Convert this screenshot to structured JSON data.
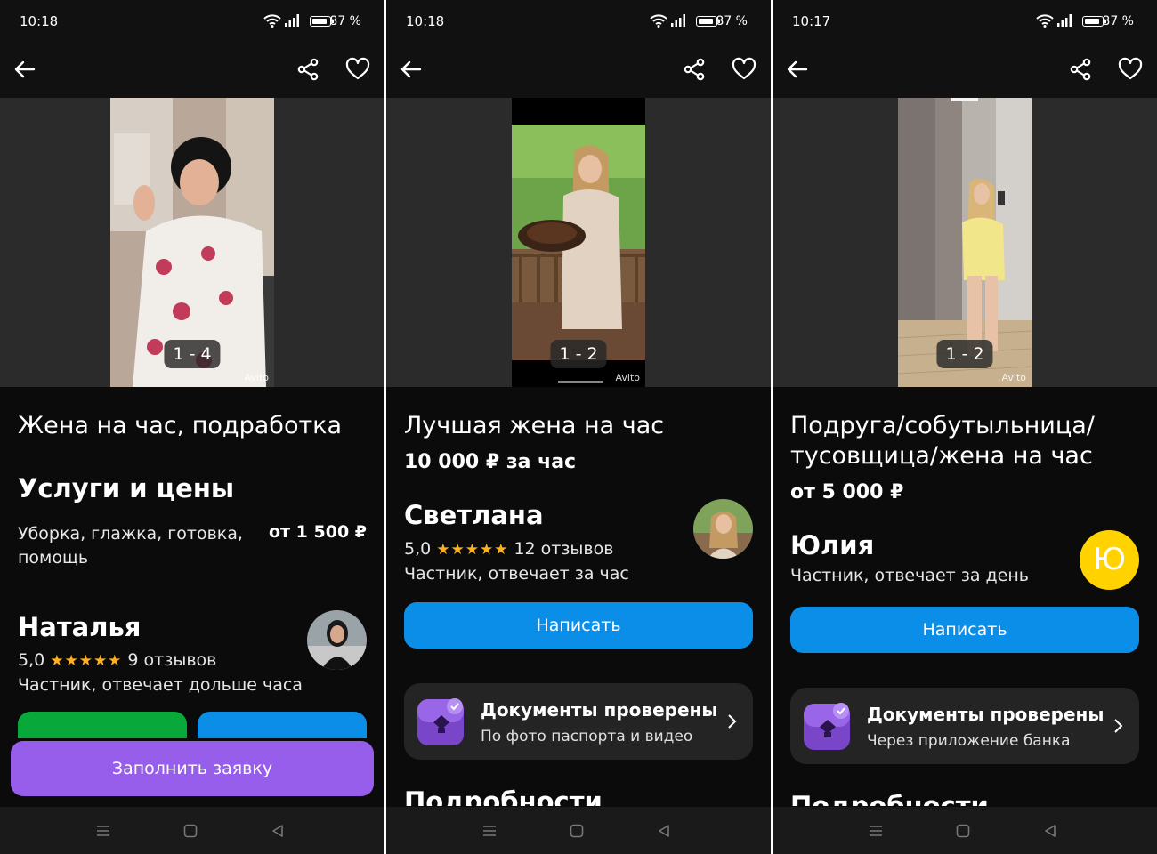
{
  "status": {
    "time1": "10:18",
    "time2": "10:18",
    "time3": "10:17",
    "battery": "87 %"
  },
  "screens": [
    {
      "counter": "1 - 4",
      "watermark": "Avito",
      "title": "Жена на час, подработка",
      "section": "Услуги и цены",
      "service": "Уборка, глажка, готовка, помощь",
      "service_price": "от 1 500 ₽",
      "seller": "Наталья",
      "rating": "5,0",
      "stars": "★★★★★",
      "reviews": "9 отзывов",
      "seller_sub": "Частник, отвечает дольше часа",
      "apply_button": "Заполнить заявку"
    },
    {
      "counter": "1 - 2",
      "watermark": "Avito",
      "title": "Лучшая жена на час",
      "price": "10 000 ₽ за час",
      "seller": "Светлана",
      "rating": "5,0",
      "stars": "★★★★★",
      "reviews": "12 отзывов",
      "seller_sub": "Частник, отвечает за час",
      "write_button": "Написать",
      "docs_title": "Документы проверены",
      "docs_sub": "По фото паспорта и видео",
      "details": "Подробности"
    },
    {
      "counter": "1 - 2",
      "watermark": "Avito",
      "title_line1": "Подруга/собутыльница/",
      "title_line2": "тусовщица/жена на час",
      "price": "от 5 000 ₽",
      "seller": "Юлия",
      "avatar_letter": "Ю",
      "seller_sub": "Частник, отвечает за день",
      "write_button": "Написать",
      "docs_title": "Документы проверены",
      "docs_sub": "Через приложение банка",
      "details": "Подробности"
    }
  ],
  "colors": {
    "accent_blue": "#0a8ee8",
    "accent_purple": "#965eeb",
    "accent_green": "#09a83a",
    "star": "#ffb020",
    "avatar_yellow": "#ffd200",
    "background": "#0b0b0b"
  },
  "icons": [
    "back-arrow-icon",
    "share-icon",
    "heart-icon",
    "wifi-icon",
    "signal-icon",
    "battery-icon",
    "verified-docs-icon",
    "chevron-right-icon",
    "menu-icon",
    "home-icon",
    "back-triangle-icon"
  ]
}
